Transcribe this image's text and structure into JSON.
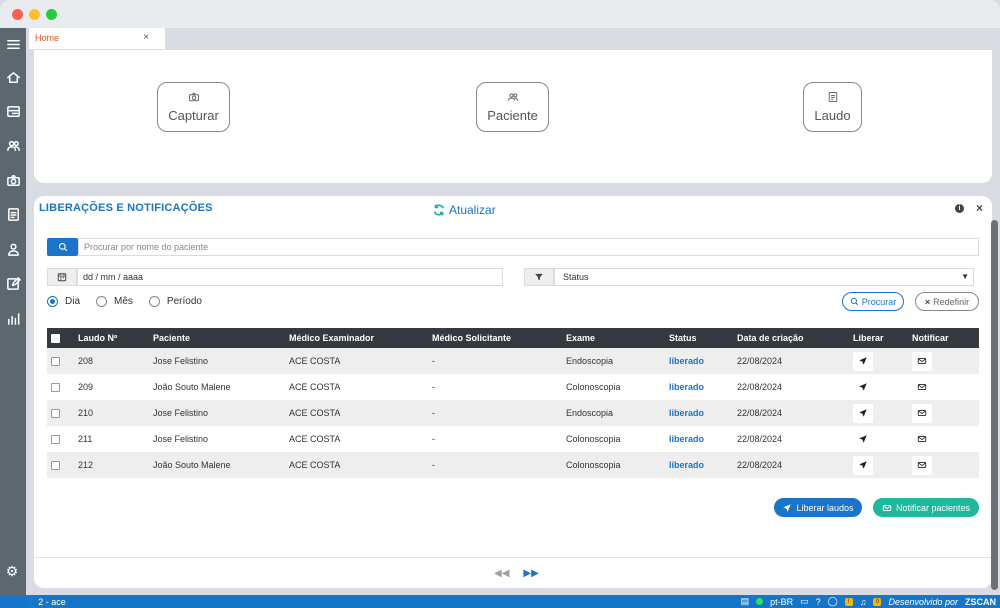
{
  "tabs": [
    {
      "label": "Home",
      "close": "×"
    }
  ],
  "quick_actions": [
    {
      "label": "Capturar",
      "icon": "camera-icon"
    },
    {
      "label": "Paciente",
      "icon": "users-icon"
    },
    {
      "label": "Laudo",
      "icon": "document-icon"
    }
  ],
  "panel": {
    "title": "LIBERAÇÕES E NOTIFICAÇÕES",
    "refresh_label": "Atualizar",
    "info": "i",
    "close": "×"
  },
  "search": {
    "placeholder": "Procurar por nome do paciente",
    "value": ""
  },
  "date_filter": {
    "value": "dd / mm / aaaa"
  },
  "status_filter": {
    "value": "Status",
    "caret": "▼"
  },
  "period_options": [
    {
      "label": "Dia",
      "selected": true
    },
    {
      "label": "Mês",
      "selected": false
    },
    {
      "label": "Período",
      "selected": false
    }
  ],
  "buttons": {
    "search": "Procurar",
    "reset": "Redefinir",
    "reset_icon": "×",
    "release_all": "Liberar laudos",
    "notify_all": "Notificar pacientes"
  },
  "table": {
    "headers": [
      "Laudo Nº",
      "Paciente",
      "Médico Examinador",
      "Médico Solicitante",
      "Exame",
      "Status",
      "Data de criação",
      "Liberar",
      "Notificar"
    ],
    "rows": [
      {
        "laudo": "208",
        "paciente": "Jose Felistino",
        "examinador": "ACE COSTA",
        "solicitante": "-",
        "exame": "Endoscopia",
        "status": "liberado",
        "data": "22/08/2024"
      },
      {
        "laudo": "209",
        "paciente": "João Souto Malene",
        "examinador": "ACE COSTA",
        "solicitante": "-",
        "exame": "Colonoscopia",
        "status": "liberado",
        "data": "22/08/2024"
      },
      {
        "laudo": "210",
        "paciente": "Jose Felistino",
        "examinador": "ACE COSTA",
        "solicitante": "-",
        "exame": "Endoscopia",
        "status": "liberado",
        "data": "22/08/2024"
      },
      {
        "laudo": "211",
        "paciente": "Jose Felistino",
        "examinador": "ACE COSTA",
        "solicitante": "-",
        "exame": "Colonoscopia",
        "status": "liberado",
        "data": "22/08/2024"
      },
      {
        "laudo": "212",
        "paciente": "João Souto Malene",
        "examinador": "ACE COSTA",
        "solicitante": "-",
        "exame": "Colonoscopia",
        "status": "liberado",
        "data": "22/08/2024"
      }
    ]
  },
  "pager": {
    "prev": "◀◀",
    "next": "▶▶"
  },
  "statusbar": {
    "user": "2 - ace",
    "lang": "pt-BR",
    "badge1": "!",
    "badge2": "0",
    "developed_by": "Desenvolvido por",
    "brand": "ZSCAN"
  },
  "colors": {
    "accent": "#1a74c7",
    "teal": "#1fb89b",
    "tab_text": "#e1541e"
  }
}
